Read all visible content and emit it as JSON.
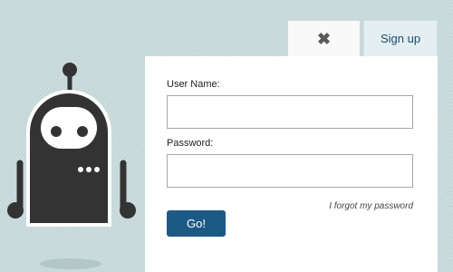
{
  "tabs": {
    "close_icon": "close-icon",
    "signup_label": "Sign up"
  },
  "form": {
    "username_label": "User Name:",
    "username_value": "",
    "password_label": "Password:",
    "password_value": "",
    "forgot_link": "I forgot my password",
    "submit_label": "Go!"
  },
  "mascot": {
    "icon": "robot-mascot-icon"
  },
  "colors": {
    "background": "#c9dbdc",
    "panel": "#ffffff",
    "button": "#1c5a86",
    "signup_text": "#1d4a6e",
    "robot": "#333333"
  }
}
